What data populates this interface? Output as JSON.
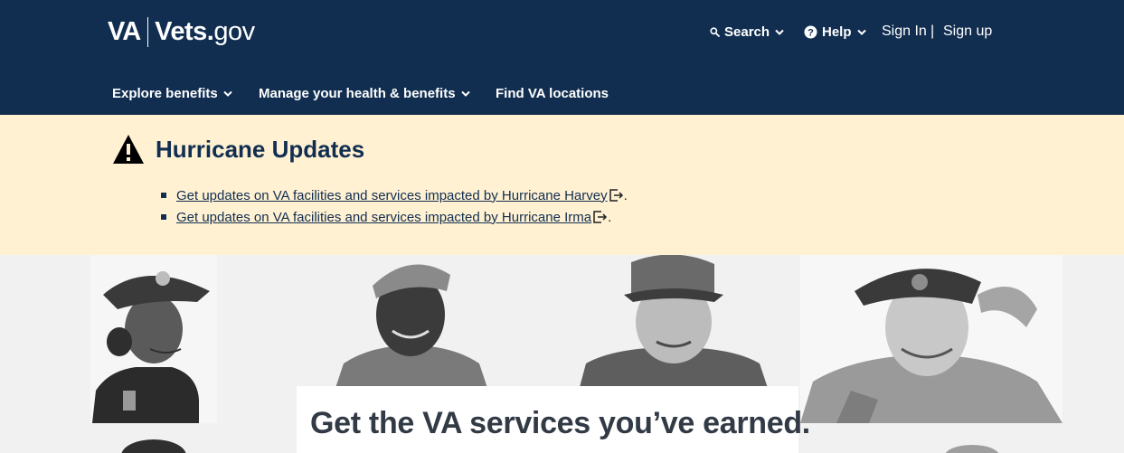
{
  "header": {
    "logo": {
      "va": "VA",
      "vets": "Vets.",
      "gov": "gov"
    },
    "utility": {
      "search_label": "Search",
      "help_label": "Help",
      "sign_in_label": "Sign In",
      "separator": "|",
      "sign_up_label": "Sign up"
    },
    "nav": {
      "explore_label": "Explore benefits",
      "manage_label": "Manage your health & benefits",
      "find_label": "Find VA locations"
    }
  },
  "alert": {
    "title": "Hurricane Updates",
    "items": [
      {
        "link": "Get updates on VA facilities and services impacted by Hurricane Harvey",
        "suffix": "."
      },
      {
        "link": "Get updates on VA facilities and services impacted by Hurricane Irma",
        "suffix": "."
      }
    ]
  },
  "hero": {
    "title": "Get the VA services you’ve earned."
  },
  "colors": {
    "header_bg": "#112e51",
    "alert_bg": "#fff1d2",
    "hero_bg": "#f1f1f1",
    "text_dark": "#323a45"
  },
  "icons": [
    "search-icon",
    "help-icon",
    "chevron-down-icon",
    "warning-icon",
    "external-link-icon"
  ]
}
